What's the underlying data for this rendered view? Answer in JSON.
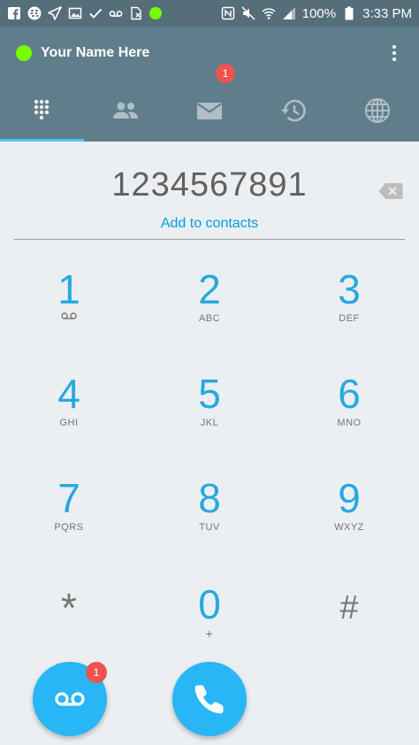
{
  "status_bar": {
    "battery": "100%",
    "time": "3:33 PM",
    "left_icons": [
      "facebook-icon",
      "blackberry-icon",
      "send-icon",
      "image-icon",
      "check-icon",
      "voicemail-icon",
      "sim-icon",
      "presence-dot-icon"
    ],
    "right_icons": [
      "nfc-icon",
      "mute-icon",
      "wifi-icon",
      "signal-icon",
      "battery-icon"
    ]
  },
  "header": {
    "user_name": "Your Name Here",
    "presence_color": "#76ff03",
    "tabs": [
      {
        "name": "dialpad",
        "icon": "dialpad-icon",
        "active": true
      },
      {
        "name": "contacts",
        "icon": "contacts-icon"
      },
      {
        "name": "messages",
        "icon": "mail-icon",
        "badge": "1"
      },
      {
        "name": "history",
        "icon": "history-icon"
      },
      {
        "name": "web",
        "icon": "globe-icon"
      }
    ]
  },
  "dialer": {
    "number": "1234567891",
    "add_contacts": "Add to contacts"
  },
  "keypad": [
    {
      "digit": "1",
      "letters": ""
    },
    {
      "digit": "2",
      "letters": "ABC"
    },
    {
      "digit": "3",
      "letters": "DEF"
    },
    {
      "digit": "4",
      "letters": "GHI"
    },
    {
      "digit": "5",
      "letters": "JKL"
    },
    {
      "digit": "6",
      "letters": "MNO"
    },
    {
      "digit": "7",
      "letters": "PQRS"
    },
    {
      "digit": "8",
      "letters": "TUV"
    },
    {
      "digit": "9",
      "letters": "WXYZ"
    },
    {
      "digit": "*",
      "letters": ""
    },
    {
      "digit": "0",
      "letters": "+"
    },
    {
      "digit": "#",
      "letters": ""
    }
  ],
  "actions": {
    "voicemail_badge": "1"
  },
  "colors": {
    "accent": "#29a8e0",
    "header": "#607d8b",
    "status_bar": "#546e7a",
    "badge": "#ef5350"
  }
}
